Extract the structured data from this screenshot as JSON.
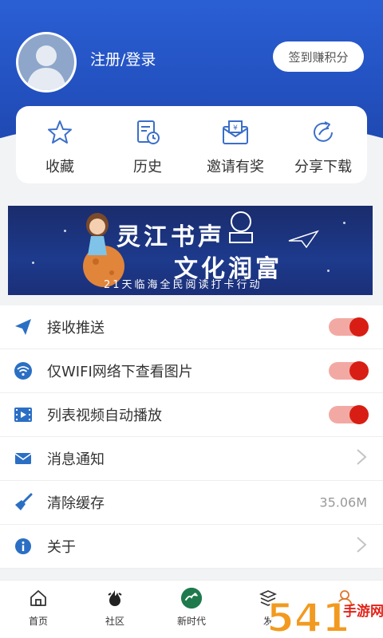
{
  "header": {
    "login_text": "注册/登录",
    "sign_button": "签到赚积分",
    "accent_color": "#2a5fd4"
  },
  "quick_actions": [
    {
      "icon": "star-icon",
      "label": "收藏"
    },
    {
      "icon": "history-icon",
      "label": "历史"
    },
    {
      "icon": "invite-envelope-icon",
      "label": "邀请有奖"
    },
    {
      "icon": "share-icon",
      "label": "分享下载"
    }
  ],
  "banner": {
    "line1": "灵江书声",
    "line2": "文化润富",
    "line3": "21天临海全民阅读打卡行动"
  },
  "settings": [
    {
      "icon": "paper-plane-icon",
      "label": "接收推送",
      "control": "toggle",
      "on": true
    },
    {
      "icon": "wifi-icon",
      "label": "仅WIFI网络下查看图片",
      "control": "toggle",
      "on": true
    },
    {
      "icon": "video-icon",
      "label": "列表视频自动播放",
      "control": "toggle",
      "on": true
    },
    {
      "icon": "mail-icon",
      "label": "消息通知",
      "control": "chevron"
    },
    {
      "icon": "broom-icon",
      "label": "清除缓存",
      "control": "value",
      "value": "35.06M"
    },
    {
      "icon": "info-icon",
      "label": "关于",
      "control": "chevron"
    }
  ],
  "bottom_nav": [
    {
      "icon": "home-icon",
      "label": "首页"
    },
    {
      "icon": "community-icon",
      "label": "社区"
    },
    {
      "icon": "new-era-icon",
      "label": "新时代"
    },
    {
      "icon": "discover-icon",
      "label": "发"
    },
    {
      "icon": "profile-icon",
      "label": ""
    }
  ],
  "watermark": "5419手游网"
}
